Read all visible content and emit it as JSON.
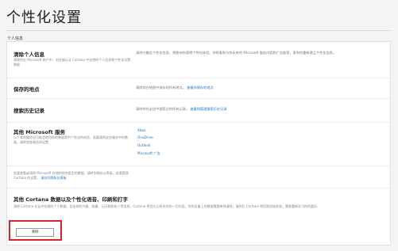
{
  "page": {
    "title": "个性化设置",
    "section_label": "个人信息"
  },
  "rows": {
    "personal": {
      "heading": "清除个人信息",
      "sub": "清除你在 Microsoft 账户中、浏览器以及 Cortana 中存储的个人信息和个性化设置数据",
      "desc": "清除兴趣及个性化信息，将影响你获得个性化体验。你将看到与你无关的 Microsoft 服务内容和广告推荐，直到你重新建立个性化信息。"
    },
    "saved_places": {
      "heading": "保存的地点",
      "desc_pre": "清除你在地图中保存的所有地点。",
      "desc_link": "查看你保存的地点"
    },
    "search_history": {
      "heading": "搜索历史记录",
      "desc_pre": "清除你在必应中搜索过的所有记录。",
      "desc_link": "查看和管理搜索历史记录"
    },
    "ms_services": {
      "heading": "其他 Microsoft 服务",
      "sub": "以下其他服务也可能会使用你的数据提供个性化的体验，若要清除这些服务中的数据，请转到各服务的设置",
      "services": [
        "Xbox",
        "OneDrive",
        "Outlook",
        "Microsoft 广告"
      ]
    },
    "privacy_note": {
      "text_pre": "若要查看或清除 Microsoft 存储的其他类型的数据，请转到隐私仪表板。若要管理 Cortana 的设置，",
      "text_link": "请访问隐私仪表板"
    },
    "cortana": {
      "heading": "其他 Cortana 数据以及个性化语音、印刷和打字",
      "desc": "清除 Cortana 在云中存储的个人数据，包括你的兴趣、收藏、日历和联系人等信息。Cortana 将会忘记有关你的一切内容，你的设备上的数据需要单独清除。清除后 Cortana 将回到初始状态，需要重新学习你的喜好。"
    }
  },
  "buttons": {
    "clear_label": "清除"
  },
  "colors": {
    "link": "#1a73c8",
    "highlight": "#d9252a"
  }
}
